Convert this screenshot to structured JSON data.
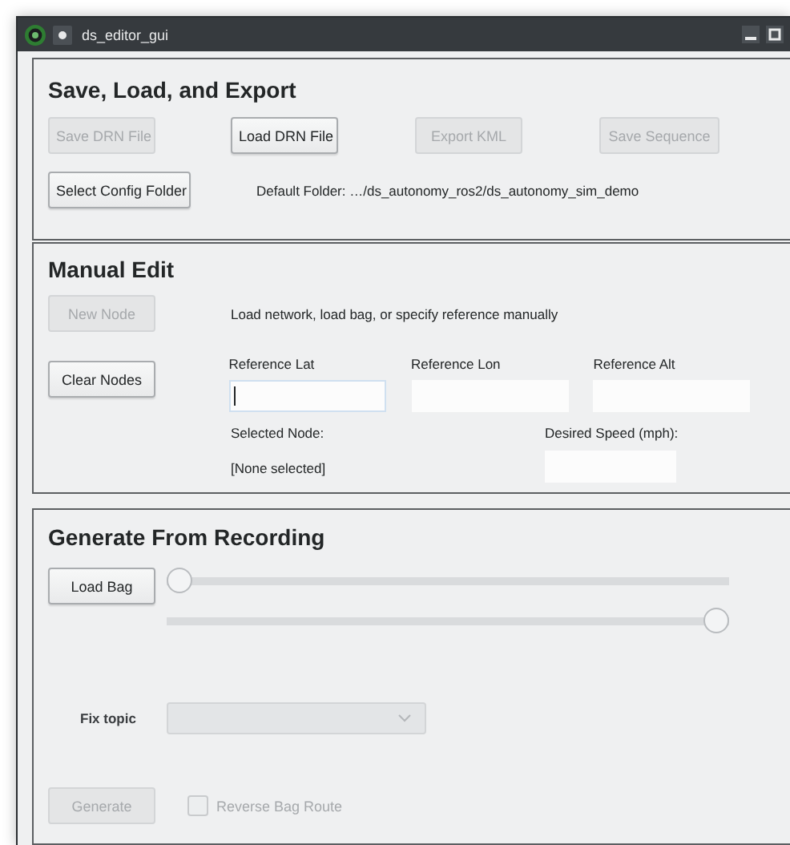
{
  "window": {
    "title": "ds_editor_gui"
  },
  "save_load_export": {
    "title": "Save, Load, and Export",
    "buttons": [
      {
        "label": "Save DRN File",
        "disabled": true
      },
      {
        "label": "Load DRN File",
        "disabled": false
      },
      {
        "label": "Export KML",
        "disabled": true
      },
      {
        "label": "Save Sequence",
        "disabled": true
      }
    ],
    "config_button": {
      "label": "Select Config Folder",
      "disabled": false
    },
    "default_folder": "Default Folder:  …/ds_autonomy_ros2/ds_autonomy_sim_demo"
  },
  "manual_edit": {
    "title": "Manual Edit",
    "new_node_button": {
      "label": "New Node",
      "disabled": true
    },
    "hint": "Load network, load bag, or specify reference manually",
    "clear_nodes_button": {
      "label": "Clear Nodes",
      "disabled": false
    },
    "reference_fields": [
      {
        "label": "Reference Lat",
        "focused": true
      },
      {
        "label": "Reference Lon",
        "focused": false
      },
      {
        "label": "Reference Alt",
        "focused": false
      }
    ],
    "selected_node_label": "Selected Node:",
    "selected_node_value": "[None selected]",
    "desired_speed": {
      "label": "Desired Speed (mph):",
      "focused": false
    }
  },
  "generate_from_recording": {
    "title": "Generate From Recording",
    "load_bag_button": {
      "label": "Load Bag",
      "disabled": false
    },
    "sliders": [
      {
        "level": 0
      },
      {
        "level": 1
      }
    ],
    "fix_topic": {
      "label": "Fix topic",
      "disabled": true
    },
    "generate_button": {
      "label": "Generate",
      "disabled": true
    },
    "reverse_bag_route": {
      "label": "Reverse Bag Route",
      "checked": false,
      "disabled": true
    }
  }
}
